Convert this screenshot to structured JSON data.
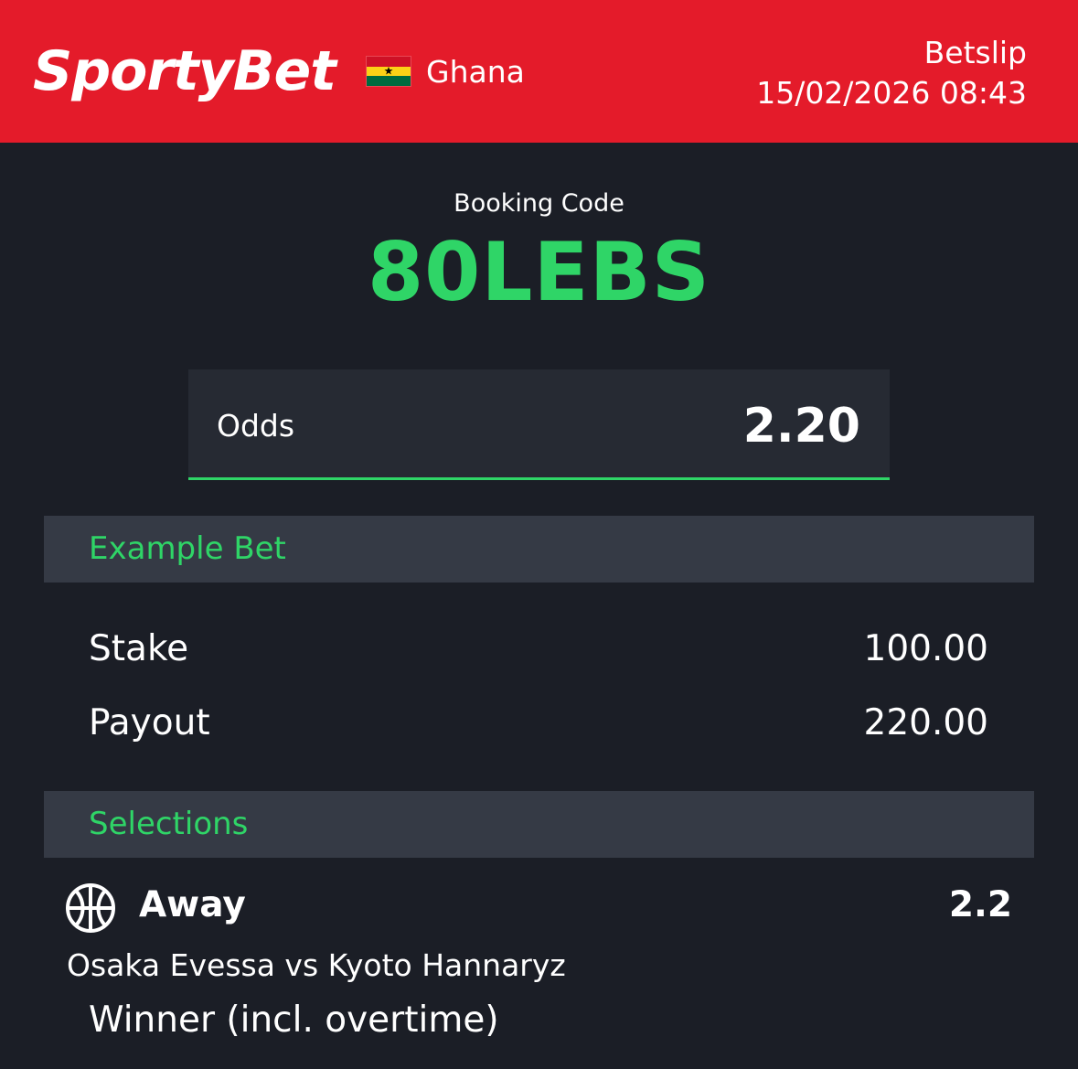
{
  "header": {
    "brand": "SportyBet",
    "country": "Ghana",
    "flag_icon": "ghana-flag-icon",
    "page_label": "Betslip",
    "datetime": "15/02/2026 08:43"
  },
  "booking": {
    "label": "Booking Code",
    "code": "80LEBS"
  },
  "odds": {
    "label": "Odds",
    "value": "2.20"
  },
  "example_bet": {
    "title": "Example Bet",
    "stake_label": "Stake",
    "stake_value": "100.00",
    "payout_label": "Payout",
    "payout_value": "220.00"
  },
  "selections": {
    "title": "Selections",
    "items": [
      {
        "icon": "basketball-icon",
        "pick": "Away",
        "odds": "2.2",
        "match": "Osaka Evessa vs Kyoto Hannaryz",
        "market": "Winner (incl. overtime)"
      }
    ]
  },
  "colors": {
    "header_bg": "#e41b2a",
    "page_bg": "#1b1e26",
    "accent_green": "#2fd567",
    "section_bg": "#353a45",
    "odds_box_bg": "#262a33"
  }
}
